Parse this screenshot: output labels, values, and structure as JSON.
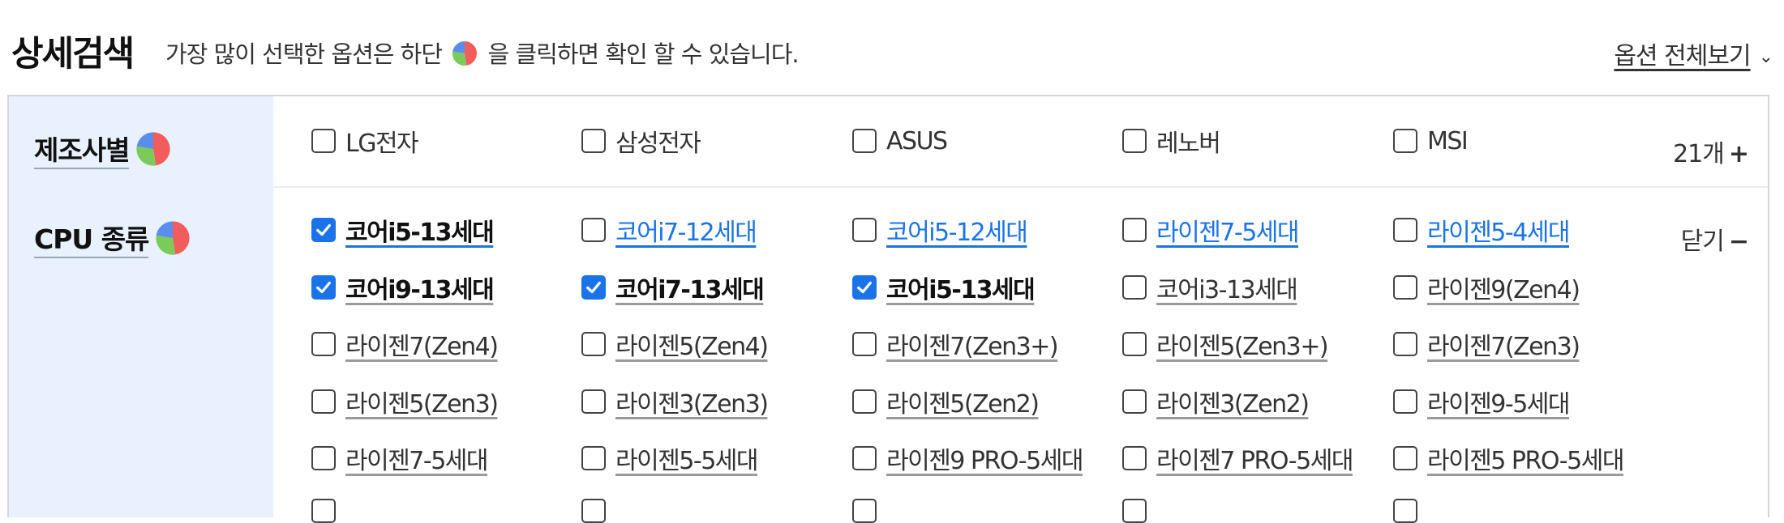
{
  "header": {
    "title": "상세검색",
    "subtitle_before": "가장 많이 선택한 옵션은 하단",
    "subtitle_after": "을 클릭하면 확인 할 수 있습니다.",
    "view_all": "옵션 전체보기",
    "view_all_icon": "chevron-down-icon"
  },
  "pie_icon": {
    "name": "pie-chart-icon",
    "colors": [
      "#f25c5c",
      "#5b8def",
      "#7acb5a"
    ]
  },
  "manufacturer": {
    "label": "제조사별",
    "options": [
      {
        "label": "LG전자",
        "checked": false
      },
      {
        "label": "삼성전자",
        "checked": false
      },
      {
        "label": "ASUS",
        "checked": false
      },
      {
        "label": "레노버",
        "checked": false
      },
      {
        "label": "MSI",
        "checked": false
      }
    ],
    "count_label": "21개",
    "count_symbol": "+"
  },
  "cpu": {
    "label": "CPU 종류",
    "close_label": "닫기",
    "close_symbol": "−",
    "rows": [
      [
        {
          "label": "코어i5-13세대",
          "checked": true,
          "style": "blue-bold"
        },
        {
          "label": "코어i7-12세대",
          "checked": false,
          "style": "blue"
        },
        {
          "label": "코어i5-12세대",
          "checked": false,
          "style": "blue"
        },
        {
          "label": "라이젠7-5세대",
          "checked": false,
          "style": "blue"
        },
        {
          "label": "라이젠5-4세대",
          "checked": false,
          "style": "blue"
        }
      ],
      [
        {
          "label": "코어i9-13세대",
          "checked": true,
          "style": "bold"
        },
        {
          "label": "코어i7-13세대",
          "checked": true,
          "style": "bold"
        },
        {
          "label": "코어i5-13세대",
          "checked": true,
          "style": "bold"
        },
        {
          "label": "코어i3-13세대",
          "checked": false,
          "style": "normal"
        },
        {
          "label": "라이젠9(Zen4)",
          "checked": false,
          "style": "normal"
        }
      ],
      [
        {
          "label": "라이젠7(Zen4)",
          "checked": false,
          "style": "normal"
        },
        {
          "label": "라이젠5(Zen4)",
          "checked": false,
          "style": "normal"
        },
        {
          "label": "라이젠7(Zen3+)",
          "checked": false,
          "style": "normal"
        },
        {
          "label": "라이젠5(Zen3+)",
          "checked": false,
          "style": "normal"
        },
        {
          "label": "라이젠7(Zen3)",
          "checked": false,
          "style": "normal"
        }
      ],
      [
        {
          "label": "라이젠5(Zen3)",
          "checked": false,
          "style": "normal"
        },
        {
          "label": "라이젠3(Zen3)",
          "checked": false,
          "style": "normal"
        },
        {
          "label": "라이젠5(Zen2)",
          "checked": false,
          "style": "normal"
        },
        {
          "label": "라이젠3(Zen2)",
          "checked": false,
          "style": "normal"
        },
        {
          "label": "라이젠9-5세대",
          "checked": false,
          "style": "normal"
        }
      ],
      [
        {
          "label": "라이젠7-5세대",
          "checked": false,
          "style": "normal"
        },
        {
          "label": "라이젠5-5세대",
          "checked": false,
          "style": "normal"
        },
        {
          "label": "라이젠9 PRO-5세대",
          "checked": false,
          "style": "normal"
        },
        {
          "label": "라이젠7 PRO-5세대",
          "checked": false,
          "style": "normal"
        },
        {
          "label": "라이젠5 PRO-5세대",
          "checked": false,
          "style": "normal"
        }
      ]
    ]
  }
}
